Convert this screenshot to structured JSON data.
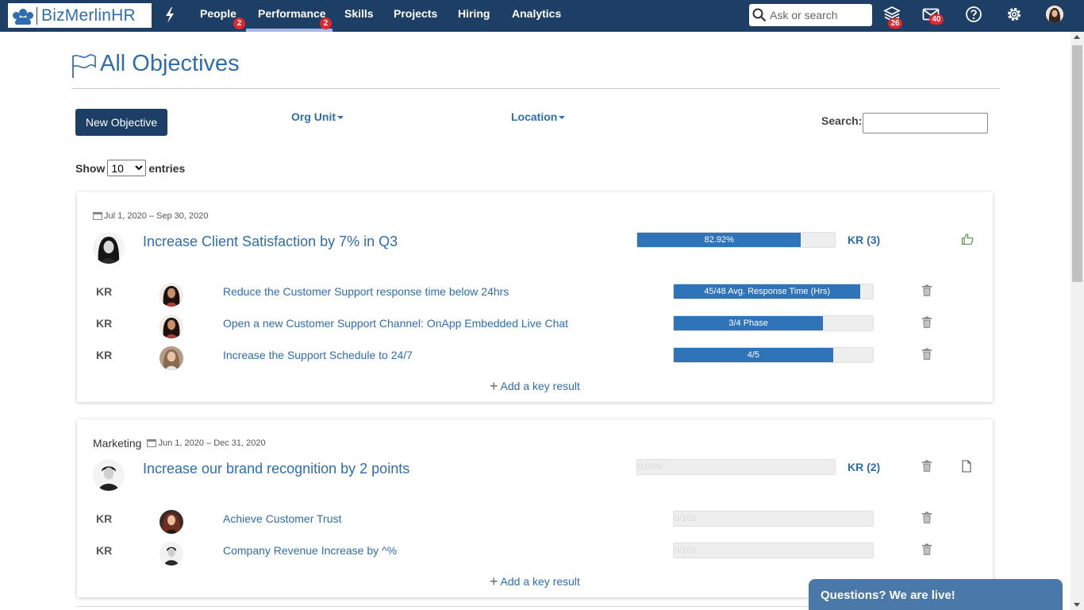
{
  "brand": {
    "name": "BizMerlinHR"
  },
  "nav": {
    "items": [
      {
        "label": "People",
        "badge": "2"
      },
      {
        "label": "Performance",
        "badge": "2"
      },
      {
        "label": "Skills"
      },
      {
        "label": "Projects"
      },
      {
        "label": "Hiring"
      },
      {
        "label": "Analytics"
      }
    ],
    "active": "Performance",
    "search_placeholder": "Ask or search",
    "layers_badge": "26",
    "mail_badge": "40"
  },
  "page": {
    "title": "All Objectives"
  },
  "controls": {
    "new_objective": "New Objective",
    "org_unit": "Org Unit",
    "location": "Location",
    "search_label": "Search:",
    "show_label": "Show",
    "entries_value": "10",
    "entries_label": "entries"
  },
  "objectives": [
    {
      "unit": "",
      "dates": "Jul 1, 2020 – Sep 30, 2020",
      "title": "Increase Client Satisfaction by 7% in Q3",
      "progress_label": "82.92%",
      "progress": 0.8292,
      "kr_count": "KR (3)",
      "action_icon": "thumbs-up-icon",
      "key_results": [
        {
          "tag": "KR",
          "title": "Reduce the Customer Support response time below 24hrs",
          "progress_label": "45/48  Avg. Response Time (Hrs)",
          "progress": 0.9375
        },
        {
          "tag": "KR",
          "title": "Open a new Customer Support Channel: OnApp Embedded Live Chat",
          "progress_label": "3/4  Phase",
          "progress": 0.75
        },
        {
          "tag": "KR",
          "title": "Increase the Support Schedule to 24/7",
          "progress_label": "4/5",
          "progress": 0.8
        }
      ],
      "add_kr": "Add a key result"
    },
    {
      "unit": "Marketing",
      "dates": "Jun 1, 2020 – Dec 31, 2020",
      "title": "Increase our brand recognition by 2 points",
      "progress_label": "0.00%",
      "progress": 0,
      "kr_count": "KR (2)",
      "action_icon": "document-icon",
      "key_results": [
        {
          "tag": "KR",
          "title": "Achieve Customer Trust",
          "progress_label": "0/100",
          "progress": 0
        },
        {
          "tag": "KR",
          "title": "Company Revenue Increase by ^%",
          "progress_label": "0/100",
          "progress": 0
        }
      ],
      "add_kr": "Add a key result"
    }
  ],
  "chat": {
    "label": "Questions? We are live!"
  },
  "colors": {
    "nav_bg": "#1d3f66",
    "accent": "#2f6db3",
    "bar_fill": "#2f74b8",
    "badge": "#e3262b"
  }
}
